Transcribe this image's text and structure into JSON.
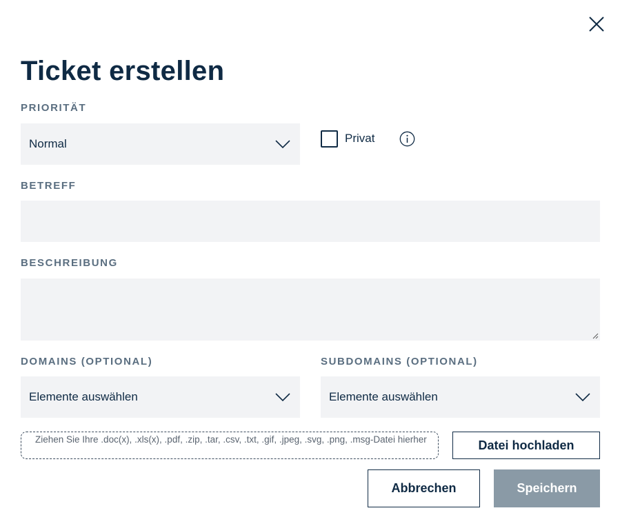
{
  "dialog": {
    "title": "Ticket erstellen",
    "close_icon": "close-icon"
  },
  "priority": {
    "label": "PRIORITÄT",
    "value": "Normal",
    "icon": "chevron-down-icon"
  },
  "private": {
    "label": "Privat",
    "checked": false,
    "info_icon": "info-icon"
  },
  "subject": {
    "label": "BETREFF",
    "value": ""
  },
  "description": {
    "label": "BESCHREIBUNG",
    "value": ""
  },
  "domains": {
    "label": "DOMAINS (OPTIONAL)",
    "value": "Elemente auswählen"
  },
  "subdomains": {
    "label": "SUBDOMAINS (OPTIONAL)",
    "value": "Elemente auswählen"
  },
  "upload": {
    "dropzone_text": "Ziehen Sie Ihre .doc(x), .xls(x), .pdf, .zip, .tar, .csv, .txt, .gif, .jpeg, .svg, .png, .msg-Datei hierher",
    "button_label": "Datei hochladen"
  },
  "actions": {
    "cancel_label": "Abbrechen",
    "save_label": "Speichern"
  },
  "colors": {
    "primary_text": "#0f2a44",
    "label_text": "#5a6e80",
    "field_background": "#f2f3f5",
    "save_button_disabled": "#8a9aa6"
  }
}
